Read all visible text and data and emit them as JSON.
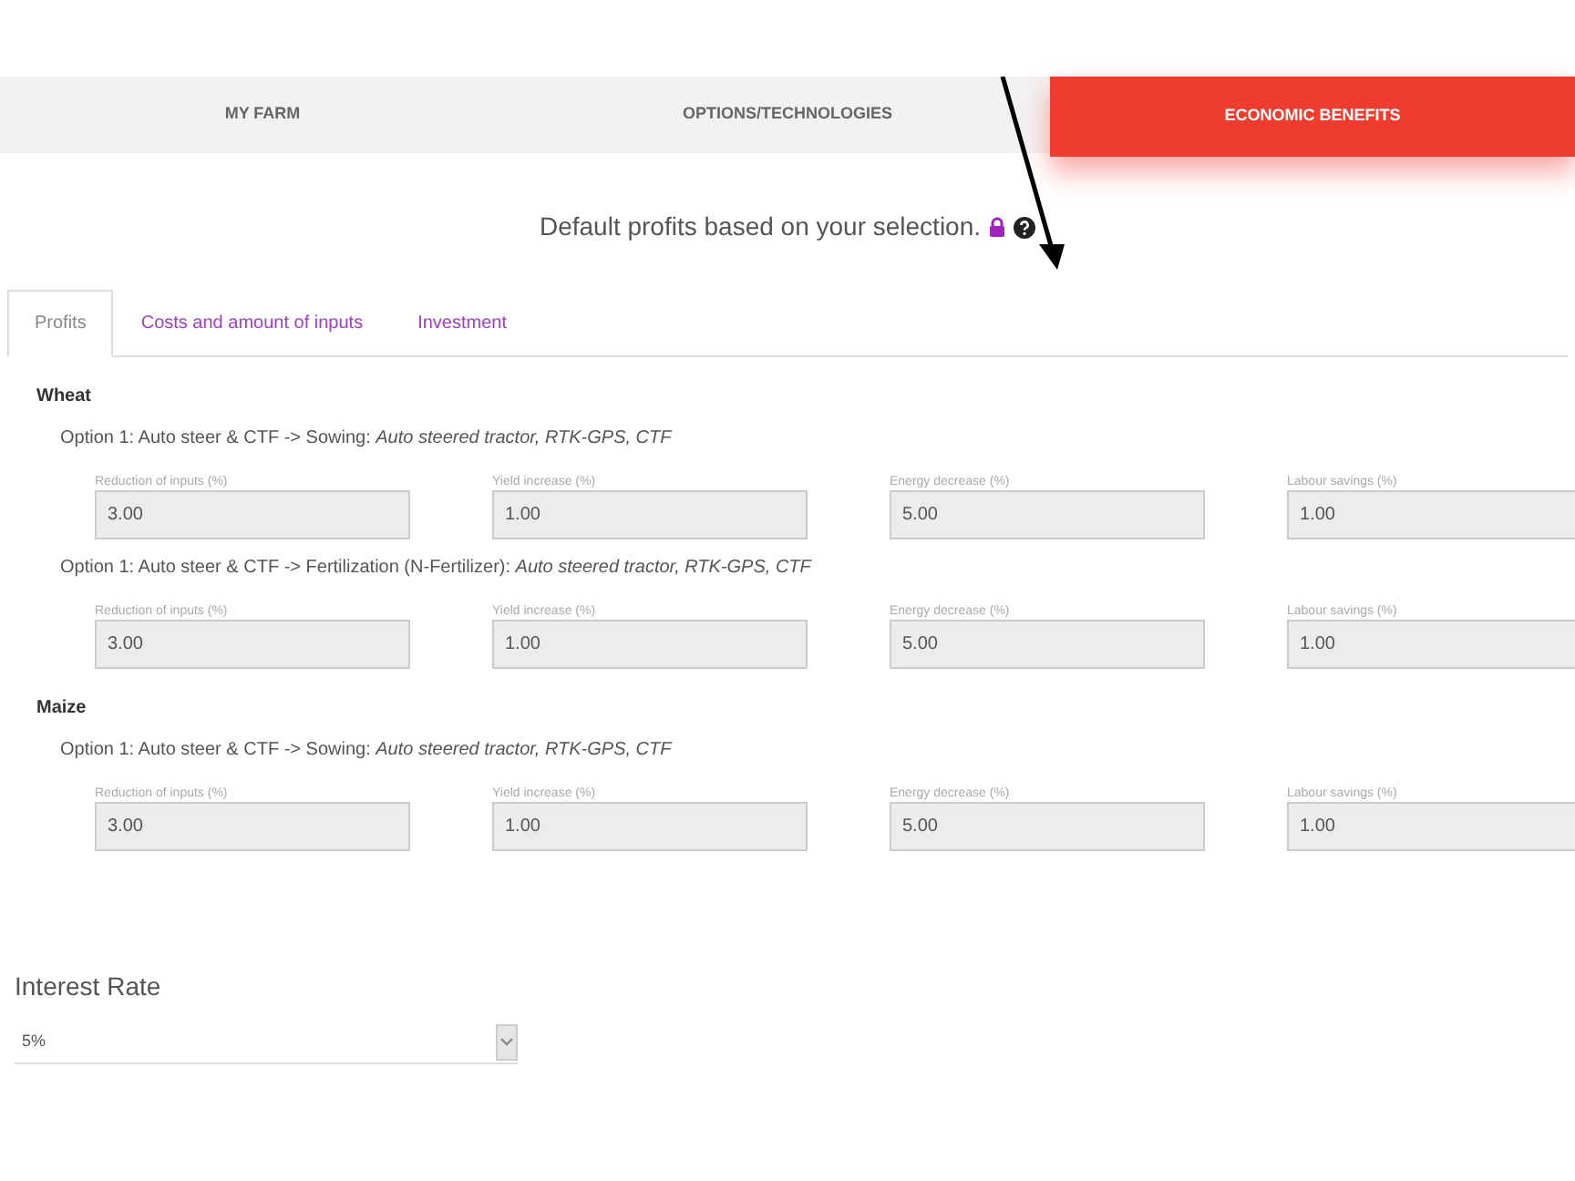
{
  "main_tabs": [
    {
      "label": "MY FARM",
      "selected": false
    },
    {
      "label": "OPTIONS/TECHNOLOGIES",
      "selected": false
    },
    {
      "label": "ECONOMIC BENEFITS",
      "selected": true
    }
  ],
  "heading": "Default profits based on your selection.",
  "sub_tabs": [
    {
      "label": "Profits",
      "selected": true
    },
    {
      "label": "Costs and amount of inputs",
      "selected": false
    },
    {
      "label": "Investment",
      "selected": false
    }
  ],
  "crops": [
    {
      "name": "Wheat",
      "options": [
        {
          "text": "Option 1: Auto steer & CTF -> Sowing: *Auto steered tractor, RTK-GPS, CTF*",
          "fields": [
            {
              "label": "Reduction of inputs (%)",
              "value": "3.00",
              "disabled": true
            },
            {
              "label": "Yield increase (%)",
              "value": "1.00",
              "disabled": true
            },
            {
              "label": "Energy decrease (%)",
              "value": "5.00",
              "disabled": true
            },
            {
              "label": "Labour savings (%)",
              "value": "1.00",
              "disabled": true
            }
          ]
        },
        {
          "text": "Option 1: Auto steer & CTF -> Fertilization (N-Fertilizer): *Auto steered tractor, RTK-GPS, CTF*",
          "fields": [
            {
              "label": "Reduction of inputs (%)",
              "value": "3.00",
              "disabled": true
            },
            {
              "label": "Yield increase (%)",
              "value": "1.00",
              "disabled": true
            },
            {
              "label": "Energy decrease (%)",
              "value": "5.00",
              "disabled": true
            },
            {
              "label": "Labour savings (%)",
              "value": "1.00",
              "disabled": true
            }
          ]
        }
      ]
    },
    {
      "name": "Maize",
      "options": [
        {
          "text": "Option 1: Auto steer & CTF -> Sowing: *Auto steered tractor, RTK-GPS, CTF*",
          "fields": [
            {
              "label": "Reduction of inputs (%)",
              "value": "3.00",
              "disabled": true
            },
            {
              "label": "Yield increase (%)",
              "value": "1.00",
              "disabled": true
            },
            {
              "label": "Energy decrease (%)",
              "value": "5.00",
              "disabled": true
            },
            {
              "label": "Labour savings (%)",
              "value": "1.00",
              "disabled": true
            }
          ]
        }
      ]
    }
  ],
  "interest_rate": {
    "label": "Interest Rate",
    "value": "5%"
  }
}
